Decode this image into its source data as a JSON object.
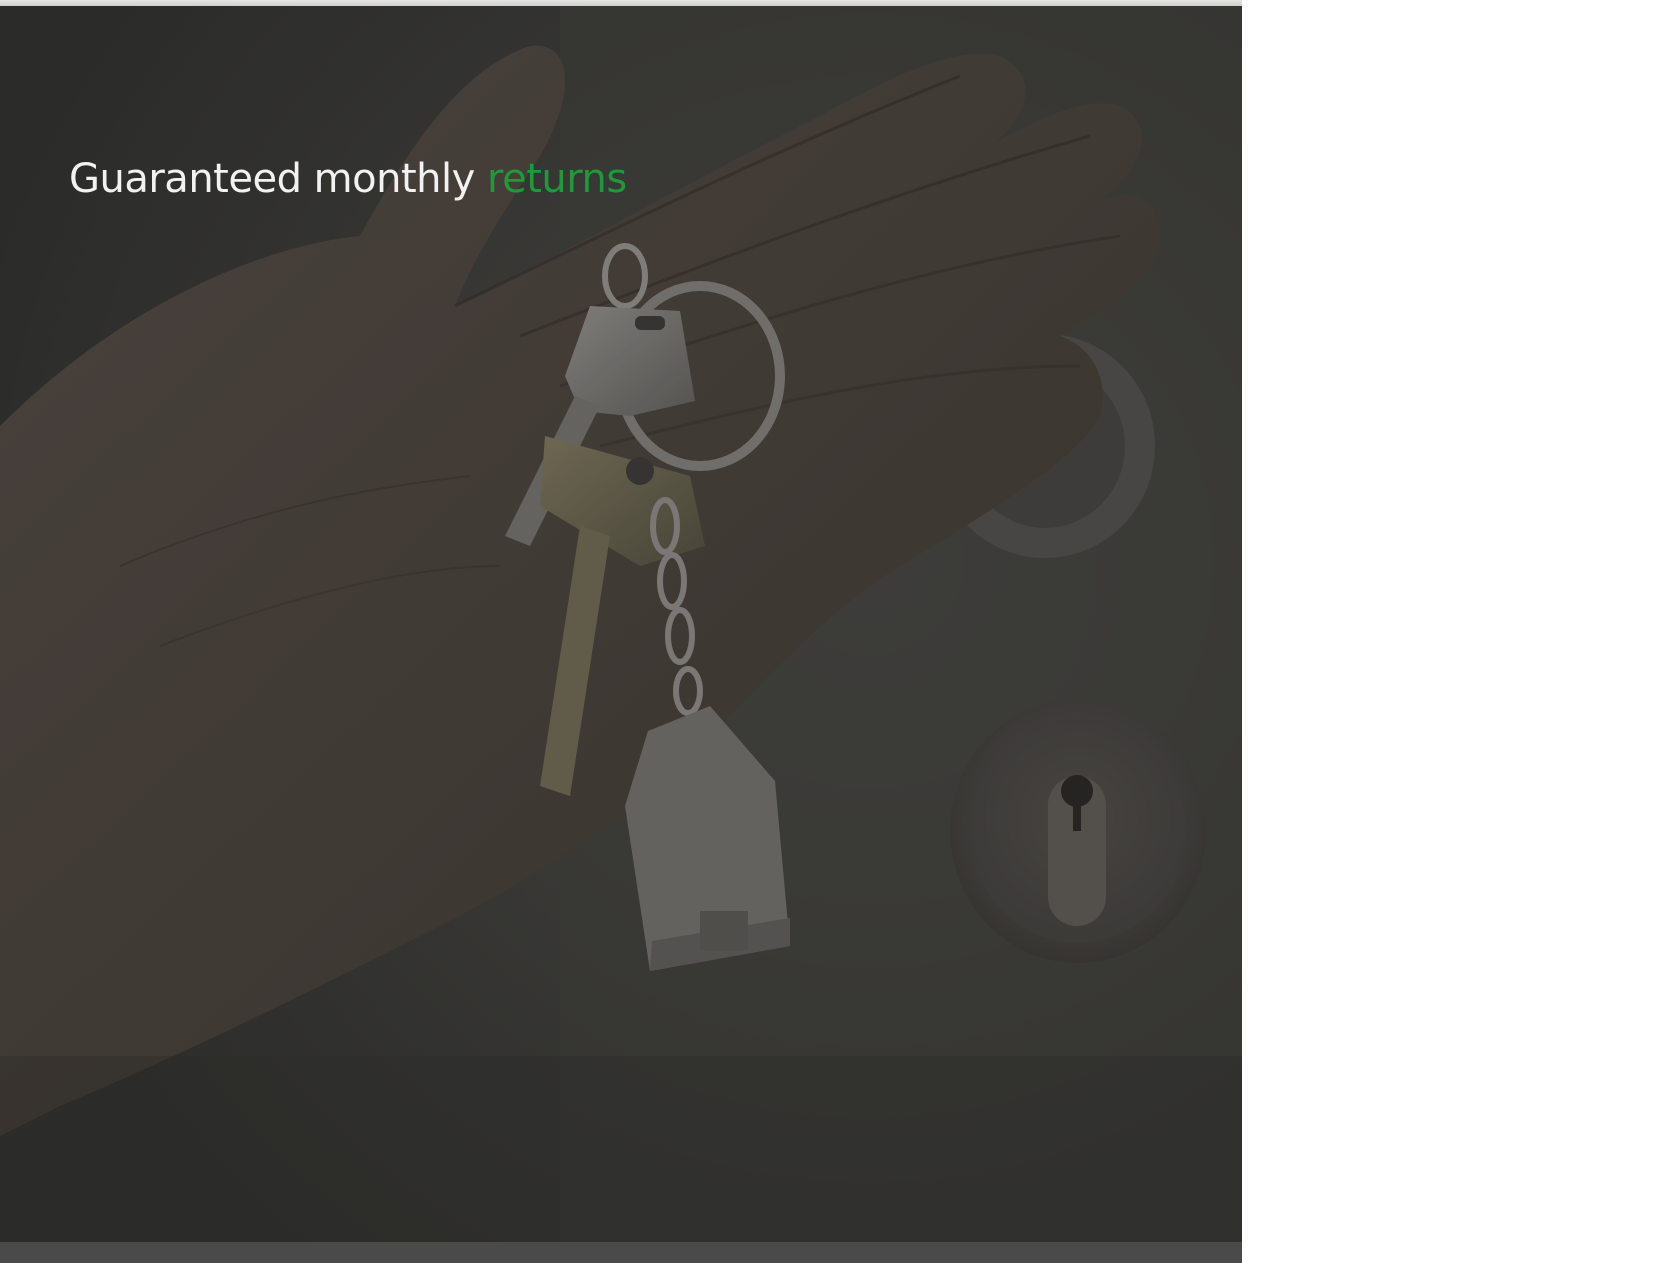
{
  "hero": {
    "headline_main": "Guaranteed monthly",
    "headline_accent": "returns",
    "image_subject": "hand-holding-house-keys-photo",
    "colors": {
      "overlay": "#3a3a38",
      "headline_text": "#f2f2f2",
      "accent": "#1e9a3a",
      "bottom_bar": "#4a4a4a"
    }
  }
}
